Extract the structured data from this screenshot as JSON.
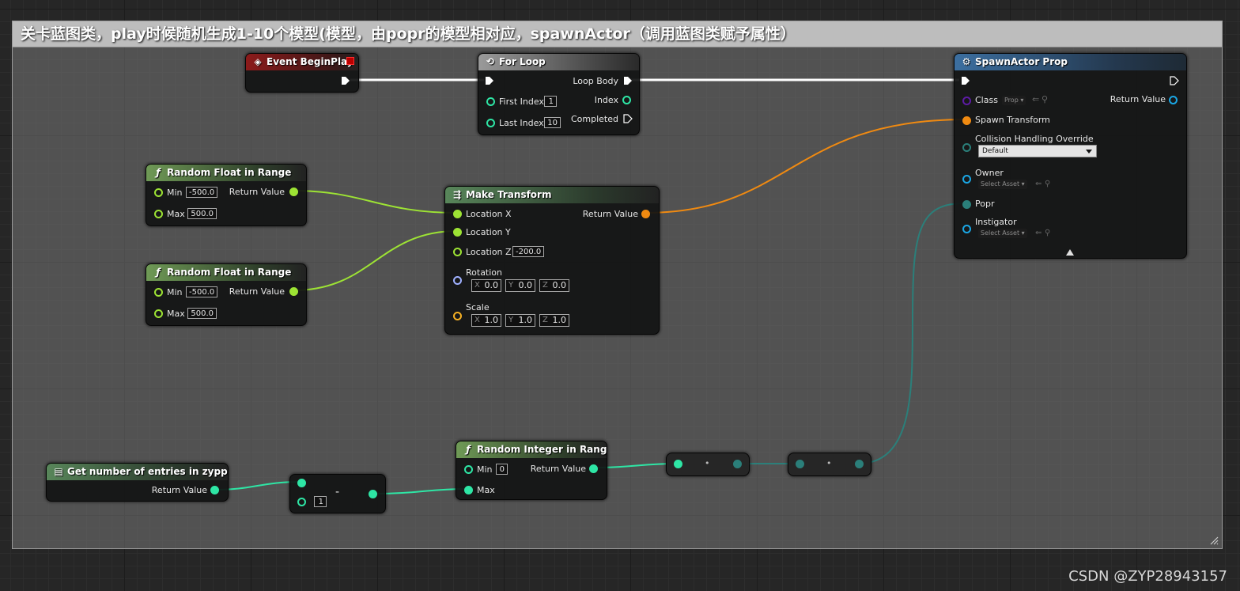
{
  "comment": {
    "title": "关卡蓝图类，play时候随机生成1-10个模型(模型，由popr的模型相对应，spawnActor（调用蓝图类赋予属性）"
  },
  "colors": {
    "exec": "#ffffff",
    "float": "#9de334",
    "integer": "#2ee6a5",
    "transform": "#f08a11",
    "class": "#5d1ba5",
    "object": "#1aa6e4",
    "struct": "#2b7f7a",
    "rotator": "#9fb0ff",
    "vector": "#f5b024"
  },
  "nodes": {
    "begin_play": {
      "title": "Event BeginPlay",
      "icon": "event-diamond-icon"
    },
    "for_loop": {
      "title": "For Loop",
      "icon": "loop-icon",
      "first_index_label": "First Index",
      "first_index_value": "1",
      "last_index_label": "Last Index",
      "last_index_value": "10",
      "loop_body_label": "Loop Body",
      "index_label": "Index",
      "completed_label": "Completed"
    },
    "rand_float_1": {
      "title": "Random Float in Range",
      "icon": "function-icon",
      "min_label": "Min",
      "min_value": "-500.0",
      "max_label": "Max",
      "max_value": "500.0",
      "return_label": "Return Value"
    },
    "rand_float_2": {
      "title": "Random Float in Range",
      "icon": "function-icon",
      "min_label": "Min",
      "min_value": "-500.0",
      "max_label": "Max",
      "max_value": "500.0",
      "return_label": "Return Value"
    },
    "make_transform": {
      "title": "Make Transform",
      "icon": "make-struct-icon",
      "loc_x_label": "Location X",
      "loc_y_label": "Location Y",
      "loc_z_label": "Location Z",
      "loc_z_value": "-200.0",
      "rotation_label": "Rotation",
      "rotation": {
        "x": "0.0",
        "y": "0.0",
        "z": "0.0"
      },
      "scale_label": "Scale",
      "scale": {
        "x": "1.0",
        "y": "1.0",
        "z": "1.0"
      },
      "axis_x": "X",
      "axis_y": "Y",
      "axis_z": "Z",
      "return_label": "Return Value"
    },
    "spawn_actor": {
      "title": "SpawnActor Prop",
      "icon": "spawn-actor-icon",
      "class_label": "Class",
      "class_value": "Prop",
      "return_label": "Return Value",
      "spawn_transform_label": "Spawn Transform",
      "collision_label": "Collision Handling Override",
      "collision_value": "Default",
      "owner_label": "Owner",
      "owner_value": "Select Asset",
      "popr_label": "Popr",
      "instigator_label": "Instigator",
      "instigator_value": "Select Asset"
    },
    "get_entries": {
      "title": "Get number of entries in zypprop",
      "icon": "data-table-icon",
      "return_label": "Return Value"
    },
    "subtract": {
      "op": "-",
      "b_value": "1"
    },
    "rand_int": {
      "title": "Random Integer in Range",
      "icon": "function-icon",
      "min_label": "Min",
      "min_value": "0",
      "max_label": "Max",
      "return_label": "Return Value"
    },
    "reroute_1": {
      "dot": "•"
    },
    "reroute_2": {
      "dot": "•"
    }
  },
  "watermark": "CSDN @ZYP28943157"
}
